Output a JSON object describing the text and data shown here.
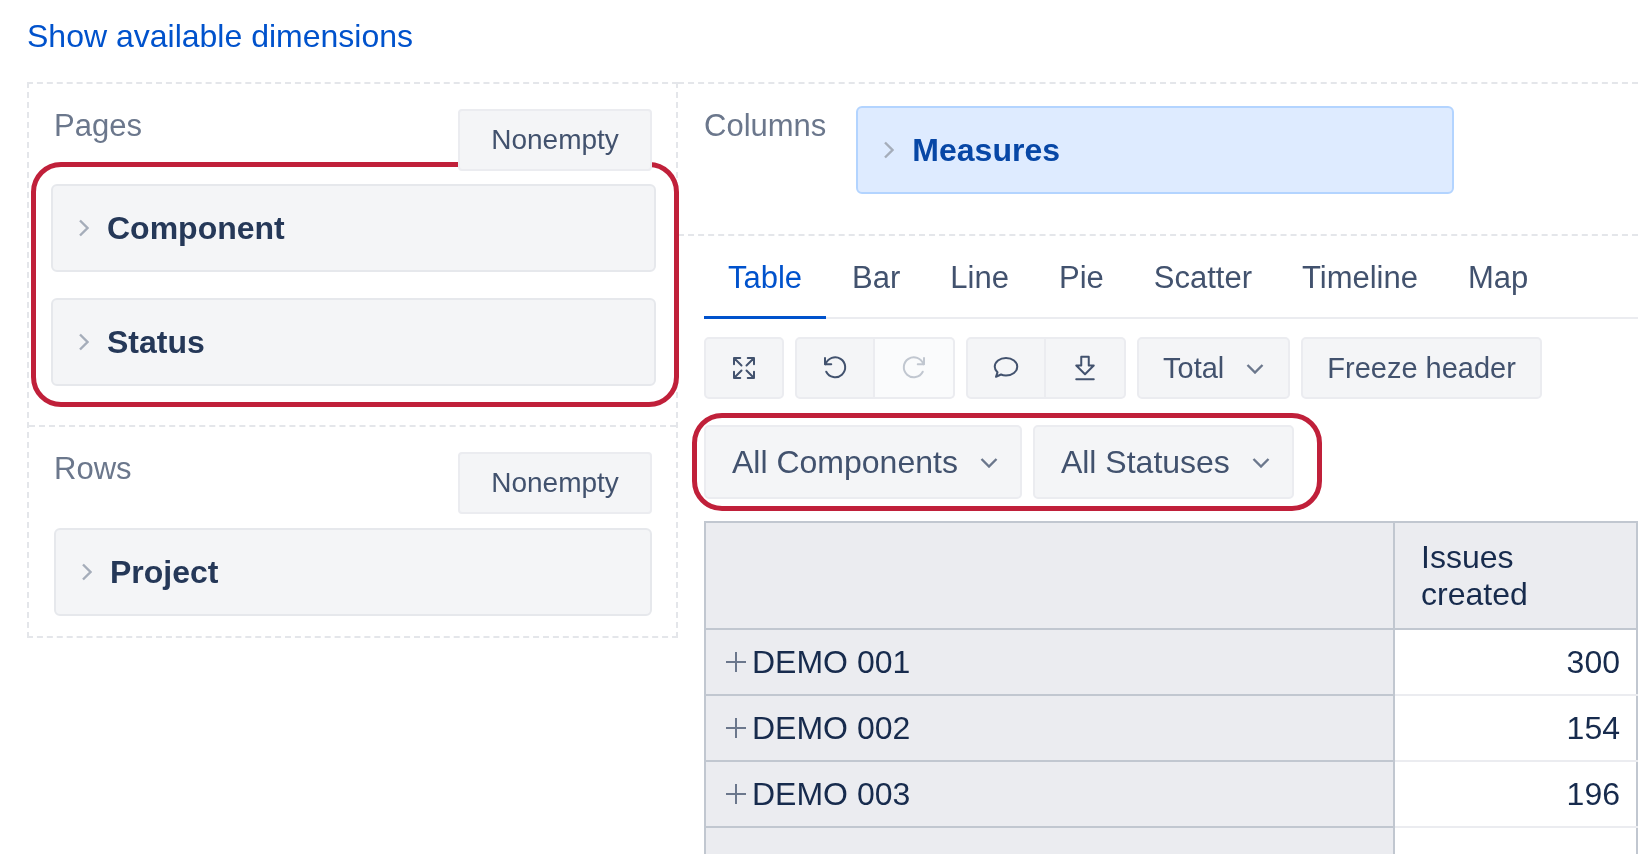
{
  "link": "Show available dimensions",
  "pages": {
    "label": "Pages",
    "button": "Nonempty",
    "items": [
      {
        "label": "Component"
      },
      {
        "label": "Status"
      }
    ]
  },
  "rows": {
    "label": "Rows",
    "button": "Nonempty",
    "items": [
      {
        "label": "Project"
      }
    ]
  },
  "columns": {
    "label": "Columns",
    "items": [
      {
        "label": "Measures"
      }
    ]
  },
  "tabs": [
    {
      "label": "Table",
      "selected": true
    },
    {
      "label": "Bar",
      "selected": false
    },
    {
      "label": "Line",
      "selected": false
    },
    {
      "label": "Pie",
      "selected": false
    },
    {
      "label": "Scatter",
      "selected": false
    },
    {
      "label": "Timeline",
      "selected": false
    },
    {
      "label": "Map",
      "selected": false
    }
  ],
  "toolbar": [
    {
      "kind": "icons",
      "buttons": [
        {
          "kind": "expand",
          "disabled": false
        }
      ]
    },
    {
      "kind": "icons",
      "buttons": [
        {
          "kind": "undo",
          "disabled": false
        },
        {
          "kind": "redo",
          "disabled": true
        }
      ]
    },
    {
      "kind": "icons",
      "buttons": [
        {
          "kind": "comment",
          "disabled": false
        },
        {
          "kind": "download",
          "disabled": false
        }
      ]
    },
    {
      "kind": "dropdown",
      "label": "Total"
    },
    {
      "kind": "button",
      "label": "Freeze header"
    }
  ],
  "filters": [
    {
      "label": "All Components"
    },
    {
      "label": "All Statuses"
    }
  ],
  "table": {
    "columns": [
      "Issues created"
    ],
    "rows": [
      {
        "label": "DEMO 001",
        "value": "300"
      },
      {
        "label": "DEMO 002",
        "value": "154"
      },
      {
        "label": "DEMO 003",
        "value": "196"
      }
    ]
  }
}
